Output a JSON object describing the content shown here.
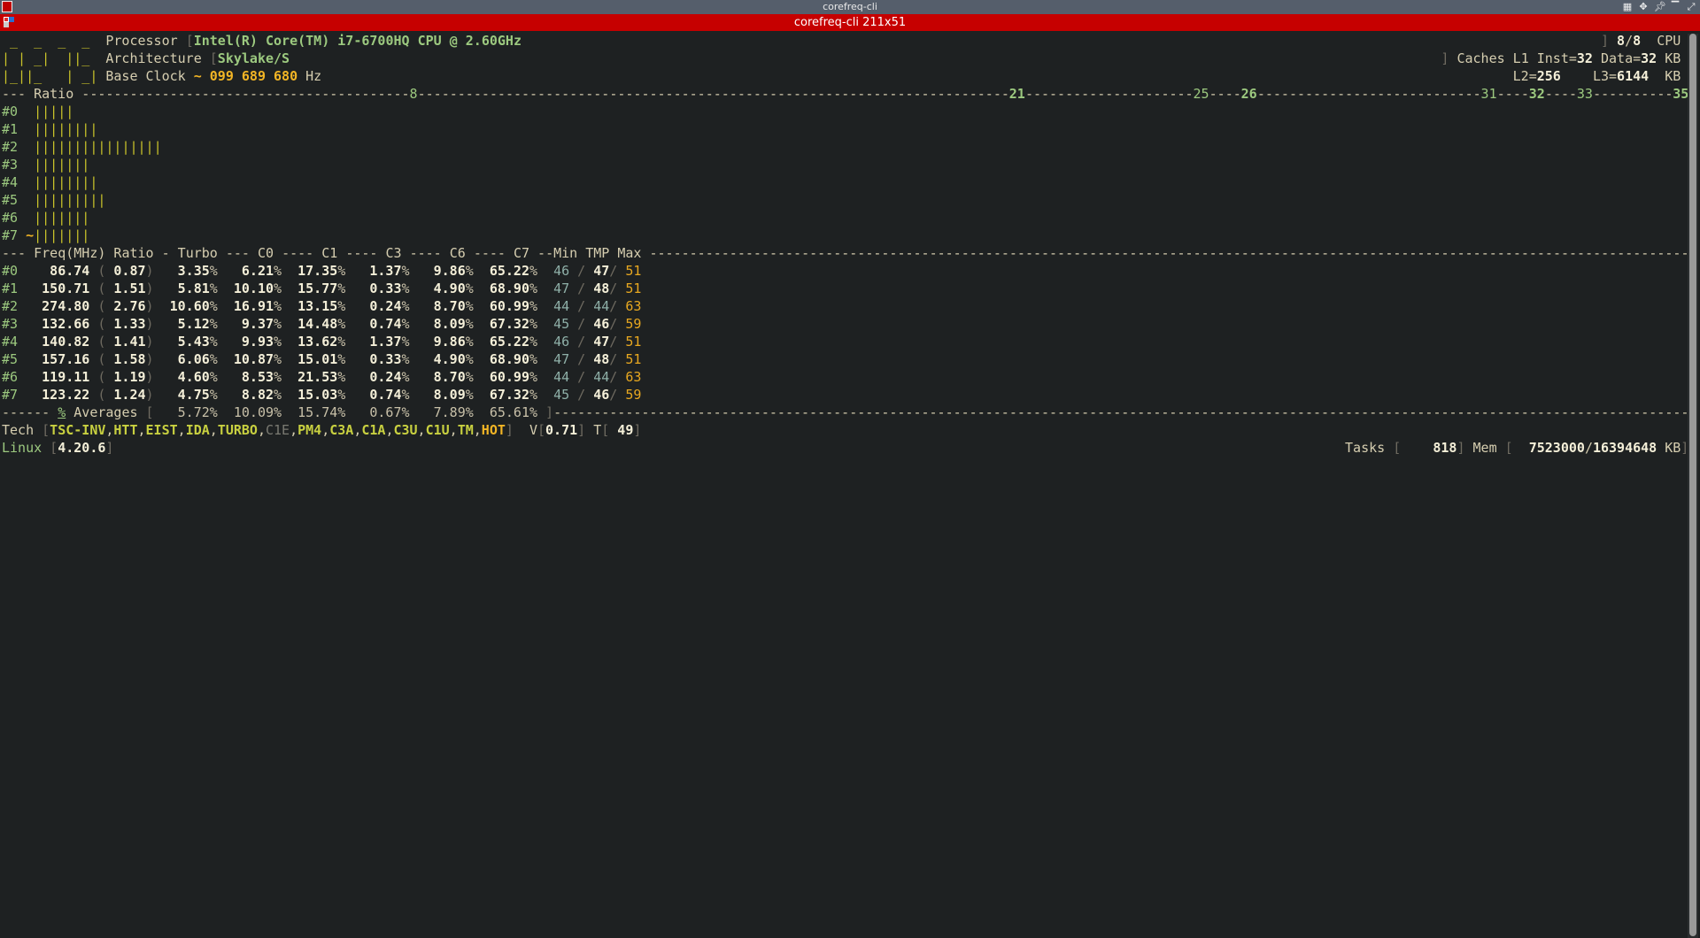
{
  "window": {
    "title": "corefreq-cli",
    "terminal_title": "corefreq-cli 211x51"
  },
  "colors": {
    "background": "#1e2122",
    "terminal_bar": "#c60000",
    "accent_green": "#9cc97f",
    "accent_orange": "#f2b525"
  },
  "header": {
    "logo": [
      " _  _  _  _",
      "| | _|  ||_",
      "|_||_   | _|"
    ],
    "processor_label": "Processor",
    "processor": "Intel(R) Core(TM) i7-6700HQ CPU @ 2.60GHz",
    "cpu_online": "8",
    "cpu_total": "8",
    "cpu_label": "CPU",
    "architecture_label": "Architecture",
    "architecture": "Skylake/S",
    "caches_label": "Caches L1",
    "l1_inst_label": "Inst",
    "l1_inst": "32",
    "l1_data_label": "Data",
    "l1_data": "32",
    "l2_label": "L2",
    "l2": "256",
    "l3_label": "L3",
    "l3": "6144",
    "cache_unit": "KB",
    "base_clock_label": "Base Clock",
    "base_clock": "099 689 680",
    "base_clock_unit": "Hz"
  },
  "ratio": {
    "label": "Ratio",
    "ticks": [
      {
        "value": "8",
        "bold": false
      },
      {
        "value": "21",
        "bold": true
      },
      {
        "value": "25",
        "bold": false
      },
      {
        "value": "26",
        "bold": true
      },
      {
        "value": "31",
        "bold": false
      },
      {
        "value": "32",
        "bold": true
      },
      {
        "value": "33",
        "bold": false
      },
      {
        "value": "35",
        "bold": true
      }
    ],
    "bars": [
      {
        "cpu": "#0",
        "count": 5,
        "marker": ""
      },
      {
        "cpu": "#1",
        "count": 8,
        "marker": ""
      },
      {
        "cpu": "#2",
        "count": 16,
        "marker": ""
      },
      {
        "cpu": "#3",
        "count": 7,
        "marker": ""
      },
      {
        "cpu": "#4",
        "count": 8,
        "marker": ""
      },
      {
        "cpu": "#5",
        "count": 9,
        "marker": ""
      },
      {
        "cpu": "#6",
        "count": 7,
        "marker": ""
      },
      {
        "cpu": "#7",
        "count": 7,
        "marker": "~"
      }
    ]
  },
  "table": {
    "header": "--- Freq(MHz) Ratio - Turbo --- C0 ---- C1 ---- C3 ---- C6 ---- C7 --Min TMP Max ",
    "rows": [
      {
        "cpu": "#0",
        "freq": "86.74",
        "ratio": "0.87",
        "turbo": "3.35",
        "c0": "6.21",
        "c1": "17.35",
        "c3": "1.37",
        "c6": "9.86",
        "c7": "65.22",
        "min": "46",
        "tmp": "47",
        "max": "51"
      },
      {
        "cpu": "#1",
        "freq": "150.71",
        "ratio": "1.51",
        "turbo": "5.81",
        "c0": "10.10",
        "c1": "15.77",
        "c3": "0.33",
        "c6": "4.90",
        "c7": "68.90",
        "min": "47",
        "tmp": "48",
        "max": "51"
      },
      {
        "cpu": "#2",
        "freq": "274.80",
        "ratio": "2.76",
        "turbo": "10.60",
        "c0": "16.91",
        "c1": "13.15",
        "c3": "0.24",
        "c6": "8.70",
        "c7": "60.99",
        "min": "44",
        "tmp": "44",
        "max": "63"
      },
      {
        "cpu": "#3",
        "freq": "132.66",
        "ratio": "1.33",
        "turbo": "5.12",
        "c0": "9.37",
        "c1": "14.48",
        "c3": "0.74",
        "c6": "8.09",
        "c7": "67.32",
        "min": "45",
        "tmp": "46",
        "max": "59"
      },
      {
        "cpu": "#4",
        "freq": "140.82",
        "ratio": "1.41",
        "turbo": "5.43",
        "c0": "9.93",
        "c1": "13.62",
        "c3": "1.37",
        "c6": "9.86",
        "c7": "65.22",
        "min": "46",
        "tmp": "47",
        "max": "51"
      },
      {
        "cpu": "#5",
        "freq": "157.16",
        "ratio": "1.58",
        "turbo": "6.06",
        "c0": "10.87",
        "c1": "15.01",
        "c3": "0.33",
        "c6": "4.90",
        "c7": "68.90",
        "min": "47",
        "tmp": "48",
        "max": "51"
      },
      {
        "cpu": "#6",
        "freq": "119.11",
        "ratio": "1.19",
        "turbo": "4.60",
        "c0": "8.53",
        "c1": "21.53",
        "c3": "0.24",
        "c6": "8.70",
        "c7": "60.99",
        "min": "44",
        "tmp": "44",
        "max": "63"
      },
      {
        "cpu": "#7",
        "freq": "123.22",
        "ratio": "1.24",
        "turbo": "4.75",
        "c0": "8.82",
        "c1": "15.03",
        "c3": "0.74",
        "c6": "8.09",
        "c7": "67.32",
        "min": "45",
        "tmp": "46",
        "max": "59"
      }
    ],
    "averages": {
      "symbol": "%",
      "label": "Averages",
      "turbo": "5.72",
      "c0": "10.09",
      "c1": "15.74",
      "c3": "0.67",
      "c6": "7.89",
      "c7": "65.61"
    }
  },
  "tech": {
    "label": "Tech",
    "features": [
      {
        "name": "TSC-INV",
        "state": "on"
      },
      {
        "name": "HTT",
        "state": "on"
      },
      {
        "name": "EIST",
        "state": "on"
      },
      {
        "name": "IDA",
        "state": "on"
      },
      {
        "name": "TURBO",
        "state": "on"
      },
      {
        "name": "C1E",
        "state": "off"
      },
      {
        "name": "PM4",
        "state": "on"
      },
      {
        "name": "C3A",
        "state": "on"
      },
      {
        "name": "C1A",
        "state": "on"
      },
      {
        "name": "C3U",
        "state": "on"
      },
      {
        "name": "C1U",
        "state": "on"
      },
      {
        "name": "TM",
        "state": "on"
      },
      {
        "name": "HOT",
        "state": "alert"
      }
    ],
    "voltage_label": "V",
    "voltage": "0.71",
    "temp_label": "T",
    "temp": "49"
  },
  "footer": {
    "os_label": "Linux",
    "kernel": "4.20.6",
    "tasks_label": "Tasks",
    "tasks": "818",
    "mem_label": "Mem",
    "mem_used": "7523000",
    "mem_total": "16394648",
    "mem_unit": "KB"
  },
  "wm_icons": [
    "tile-icon",
    "move-icon",
    "pin-icon",
    "shade-icon",
    "maximize-icon"
  ]
}
